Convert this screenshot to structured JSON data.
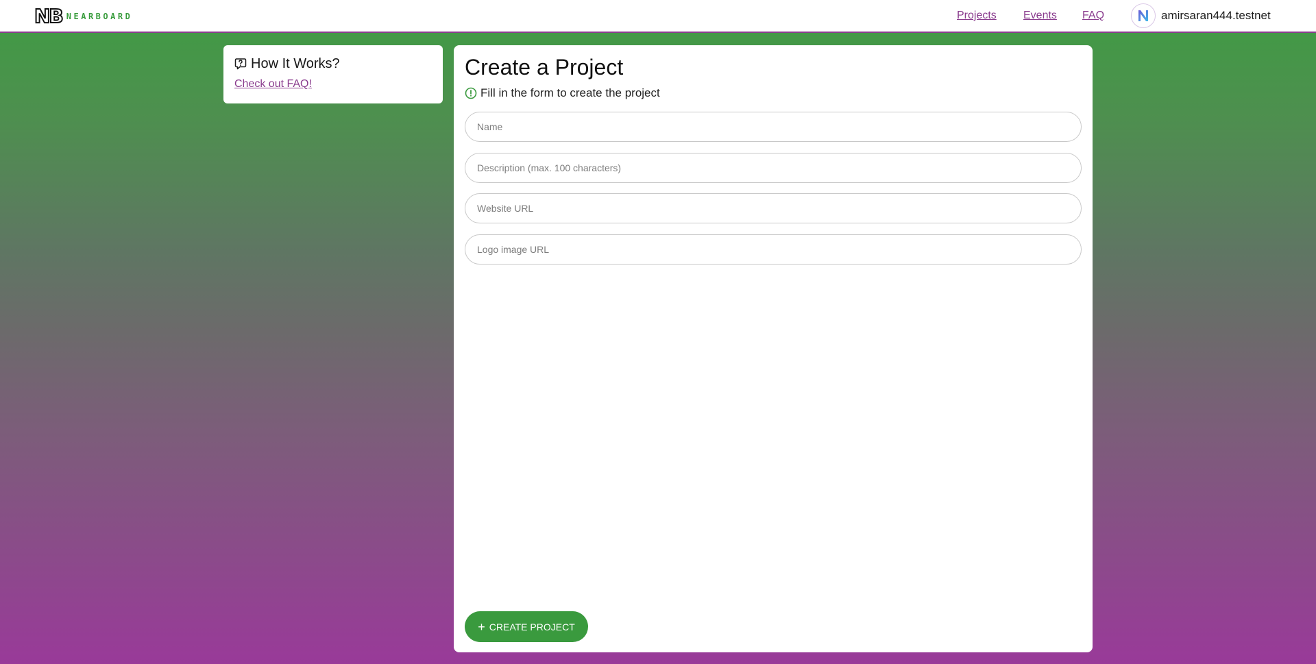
{
  "header": {
    "logo_mark": "NB",
    "logo_word": "NEARBOARD",
    "nav": [
      {
        "label": "Projects"
      },
      {
        "label": "Events"
      },
      {
        "label": "FAQ"
      }
    ],
    "account_name": "amirsaran444.testnet",
    "avatar_icon": "near-logo-icon",
    "link_color": "#8a3c8e",
    "brand_green": "#3a9d3e"
  },
  "sidebar": {
    "title": "How It Works?",
    "icon": "question-bubble-icon",
    "link": "Check out FAQ!"
  },
  "main": {
    "title": "Create a Project",
    "hint": "Fill in the form to create the project",
    "hint_icon": "info-circle-icon",
    "fields": [
      {
        "placeholder": "Name",
        "value": ""
      },
      {
        "placeholder": "Description (max. 100 characters)",
        "value": ""
      },
      {
        "placeholder": "Website URL",
        "value": ""
      },
      {
        "placeholder": "Logo image URL",
        "value": ""
      }
    ],
    "submit_label": "CREATE PROJECT",
    "submit_icon": "plus-icon",
    "accent_color": "#3a9a3e"
  }
}
